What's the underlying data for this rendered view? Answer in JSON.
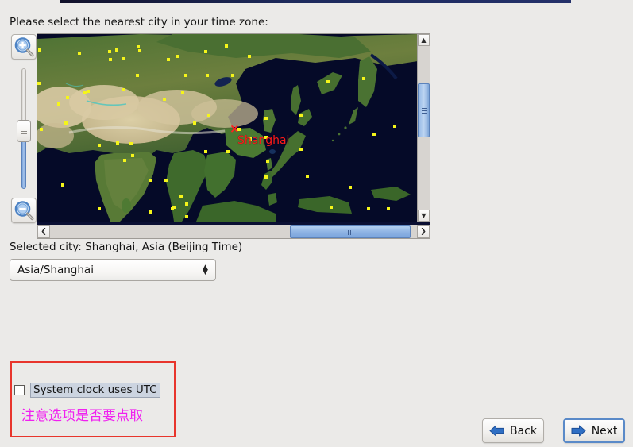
{
  "window": {
    "accent_bar_color": "#1d2a5c",
    "background_color": "#ebeae8"
  },
  "prompt": {
    "text": "Please select the nearest city in your time zone:"
  },
  "map": {
    "zoom_in_icon": "magnifier-plus-icon",
    "zoom_out_icon": "magnifier-minus-icon",
    "slider_name": "map-zoom-slider",
    "selected_marker_glyph": "×",
    "selected_marker_color": "#ff2020",
    "city_label": "Shanghai",
    "city_label_color": "#ff1a1a",
    "vscroll_up_glyph": "▲",
    "vscroll_down_glyph": "▼",
    "hscroll_left_glyph": "❮",
    "hscroll_right_glyph": "❯",
    "ocean_color": "#050a28",
    "city_dot_color": "#f5f51a"
  },
  "selection": {
    "selected_city_text": "Selected city: Shanghai, Asia (Beijing Time)",
    "timezone_value": "Asia/Shanghai",
    "timezone_placeholder": "Asia/Shanghai",
    "combo_up_glyph": "▲",
    "combo_down_glyph": "▼"
  },
  "annotation": {
    "box_color": "#e8352c",
    "checkbox_label": "System clock uses UTC",
    "checkbox_checked": false,
    "note_text": "注意选项是否要点取",
    "note_color": "#f020f0"
  },
  "navigation": {
    "back_label": "Back",
    "next_label": "Next",
    "back_icon": "arrow-left-icon",
    "next_icon": "arrow-right-icon",
    "arrow_color": "#2f6fc4"
  }
}
